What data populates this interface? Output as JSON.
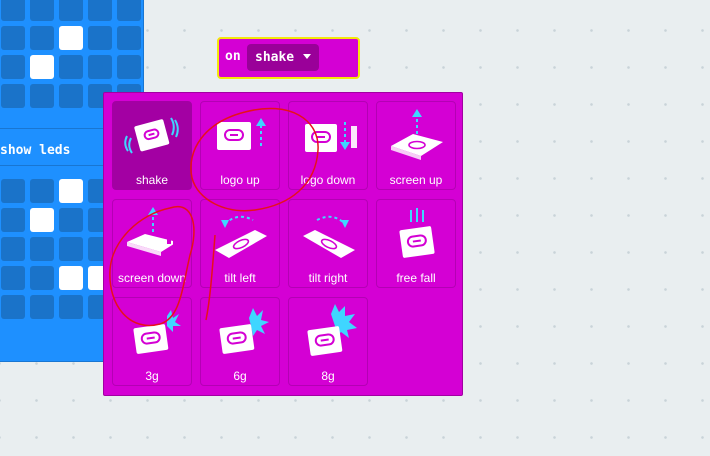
{
  "blocks": {
    "show_leds_label": "show leds",
    "on_label": "on",
    "gesture_selected": "shake"
  },
  "menu": {
    "items": [
      {
        "label": "shake",
        "icon": "shake-icon",
        "selected": true
      },
      {
        "label": "logo up",
        "icon": "logo-up-icon",
        "selected": false
      },
      {
        "label": "logo down",
        "icon": "logo-down-icon",
        "selected": false
      },
      {
        "label": "screen up",
        "icon": "screen-up-icon",
        "selected": false
      },
      {
        "label": "screen down",
        "icon": "screen-down-icon",
        "selected": false
      },
      {
        "label": "tilt left",
        "icon": "tilt-left-icon",
        "selected": false
      },
      {
        "label": "tilt right",
        "icon": "tilt-right-icon",
        "selected": false
      },
      {
        "label": "free fall",
        "icon": "free-fall-icon",
        "selected": false
      },
      {
        "label": "3g",
        "icon": "3g-icon",
        "selected": false
      },
      {
        "label": "6g",
        "icon": "6g-icon",
        "selected": false
      },
      {
        "label": "8g",
        "icon": "8g-icon",
        "selected": false
      }
    ]
  },
  "colors": {
    "event_block": "#d400d4",
    "dropdown_dark": "#9a0099",
    "basic_block": "#1e90ff",
    "highlight_outline": "#f5e60a",
    "accent_cyan": "#3fd6ff",
    "annotation_red": "#e8101a"
  }
}
